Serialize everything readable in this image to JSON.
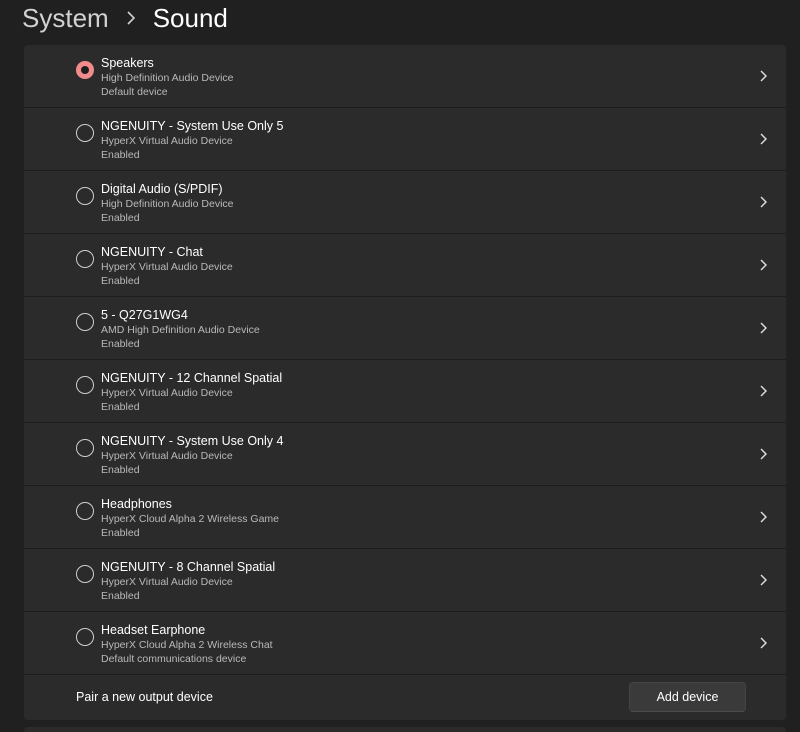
{
  "breadcrumb": {
    "parent": "System",
    "separator_icon": "chevron-right-icon",
    "current": "Sound"
  },
  "devices": [
    {
      "name": "Speakers",
      "subtitle": "High Definition Audio Device",
      "status": "Default device",
      "selected": true
    },
    {
      "name": "NGENUITY - System Use Only 5",
      "subtitle": "HyperX Virtual Audio Device",
      "status": "Enabled",
      "selected": false
    },
    {
      "name": "Digital Audio (S/PDIF)",
      "subtitle": "High Definition Audio Device",
      "status": "Enabled",
      "selected": false
    },
    {
      "name": "NGENUITY - Chat",
      "subtitle": "HyperX Virtual Audio Device",
      "status": "Enabled",
      "selected": false
    },
    {
      "name": "5 - Q27G1WG4",
      "subtitle": "AMD High Definition Audio Device",
      "status": "Enabled",
      "selected": false
    },
    {
      "name": "NGENUITY - 12 Channel Spatial",
      "subtitle": "HyperX Virtual Audio Device",
      "status": "Enabled",
      "selected": false
    },
    {
      "name": "NGENUITY - System Use Only 4",
      "subtitle": "HyperX Virtual Audio Device",
      "status": "Enabled",
      "selected": false
    },
    {
      "name": "Headphones",
      "subtitle": "HyperX Cloud Alpha 2 Wireless Game",
      "status": "Enabled",
      "selected": false
    },
    {
      "name": "NGENUITY - 8 Channel Spatial",
      "subtitle": "HyperX Virtual Audio Device",
      "status": "Enabled",
      "selected": false
    },
    {
      "name": "Headset Earphone",
      "subtitle": "HyperX Cloud Alpha 2 Wireless Chat",
      "status": "Default communications device",
      "selected": false
    }
  ],
  "pair": {
    "label": "Pair a new output device",
    "button_label": "Add device"
  },
  "colors": {
    "accent": "#f28b8b",
    "background": "#202020",
    "card": "#2b2b2b"
  }
}
